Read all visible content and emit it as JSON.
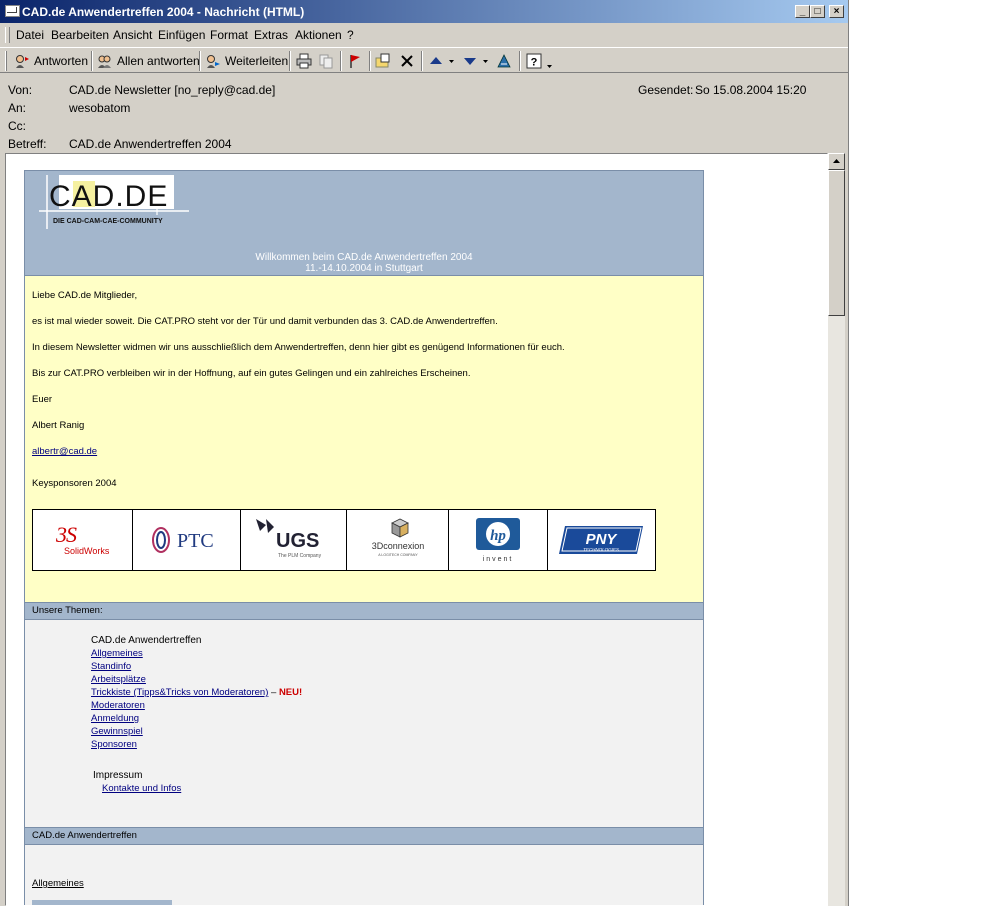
{
  "window": {
    "title": "CAD.de Anwendertreffen 2004 - Nachricht (HTML)",
    "controls": {
      "minimize": "_",
      "maximize": "□",
      "close": "×"
    }
  },
  "menu": [
    "Datei",
    "Bearbeiten",
    "Ansicht",
    "Einfügen",
    "Format",
    "Extras",
    "Aktionen",
    "?"
  ],
  "toolbar": {
    "reply": "Antworten",
    "reply_all": "Allen antworten",
    "forward": "Weiterleiten"
  },
  "header": {
    "from_label": "Von:",
    "from_value": "CAD.de Newsletter [no_reply@cad.de]",
    "to_label": "An:",
    "to_value": "wesobatom",
    "cc_label": "Cc:",
    "cc_value": "",
    "subject_label": "Betreff:",
    "subject_value": "CAD.de Anwendertreffen 2004",
    "sent_label": "Gesendet:",
    "sent_value": "So 15.08.2004 15:20"
  },
  "mail": {
    "logo_text": "CAD.DE",
    "logo_sub": "DIE CAD-CAM-CAE-COMMUNITY",
    "welcome_line1": "Willkommen beim CAD.de Anwendertreffen 2004",
    "welcome_line2": "11.-14.10.2004 in Stuttgart",
    "greeting": "Liebe CAD.de Mitglieder,",
    "p1": "es ist mal wieder soweit. Die CAT.PRO steht vor der Tür und damit verbunden das 3. CAD.de Anwendertreffen.",
    "p2": "In diesem Newsletter widmen wir uns ausschließlich dem Anwendertreffen, denn hier gibt es genügend Informationen für euch.",
    "p3": "Bis zur CAT.PRO verbleiben wir in der Hoffnung, auf ein gutes Gelingen und ein zahlreiches Erscheinen.",
    "sign1": "Euer",
    "sign2": "Albert Ranig",
    "email": "albertr@cad.de",
    "sponsors_label": "Keysponsoren 2004",
    "sponsors": {
      "solidworks": "SolidWorks",
      "ptc": "PTC",
      "ugs": "UGS",
      "ugs_sub": "The PLM Company",
      "connexion": "3Dconnexion",
      "connexion_sub": "A LOGITECH COMPANY",
      "hp_sub": "invent",
      "pny": "PNY",
      "pny_sub": "TECHNOLOGIES"
    },
    "themes_title": "Unsere Themen:",
    "themes_head": "CAD.de Anwendertreffen",
    "themes_links": [
      "Allgemeines",
      "Standinfo",
      "Arbeitsplätze",
      "Trickkiste (Tipps&Tricks von Moderatoren)",
      "Moderatoren",
      "Anmeldung",
      "Gewinnspiel",
      "Sponsoren"
    ],
    "new_marker_sep": " – ",
    "new_marker": "NEU!",
    "impressum": "Impressum",
    "impressum_link": "Kontakte und Infos",
    "section2_title": "CAD.de Anwendertreffen",
    "section2_link": "Allgemeines"
  }
}
